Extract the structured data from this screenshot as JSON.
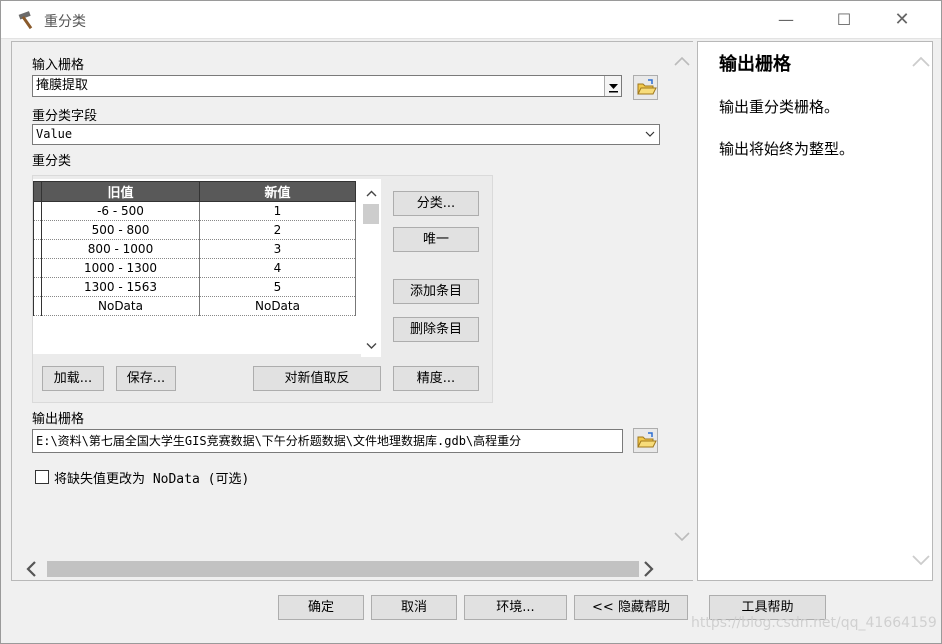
{
  "window": {
    "title": "重分类",
    "min_glyph": "—",
    "max_glyph": "☐",
    "close_glyph": "✕"
  },
  "input_raster": {
    "label": "输入栅格",
    "value": "掩膜提取"
  },
  "reclass_field": {
    "label": "重分类字段",
    "value": "Value"
  },
  "reclassification": {
    "label": "重分类",
    "columns": [
      "旧值",
      "新值"
    ],
    "rows": [
      {
        "old": "-6 - 500",
        "new": "1"
      },
      {
        "old": "500 - 800",
        "new": "2"
      },
      {
        "old": "800 - 1000",
        "new": "3"
      },
      {
        "old": "1000 - 1300",
        "new": "4"
      },
      {
        "old": "1300 - 1563",
        "new": "5"
      },
      {
        "old": "NoData",
        "new": "NoData"
      }
    ],
    "buttons": {
      "classify": "分类...",
      "unique": "唯一",
      "add_entry": "添加条目",
      "delete_entry": "删除条目",
      "load": "加载...",
      "save": "保存...",
      "reverse": "对新值取反",
      "precision": "精度..."
    }
  },
  "output_raster": {
    "label": "输出栅格",
    "value": "E:\\资料\\第七届全国大学生GIS竞赛数据\\下午分析题数据\\文件地理数据库.gdb\\高程重分"
  },
  "nodata_option": {
    "label": "将缺失值更改为 NoData (可选)",
    "checked": false
  },
  "help": {
    "title": "输出栅格",
    "paragraphs": [
      "输出重分类栅格。",
      "输出将始终为整型。"
    ]
  },
  "footer": {
    "ok": "确定",
    "cancel": "取消",
    "environments": "环境...",
    "hide_help": "<< 隐藏帮助",
    "tool_help": "工具帮助"
  },
  "watermark": "https://blog.csdn.net/qq_41664159"
}
